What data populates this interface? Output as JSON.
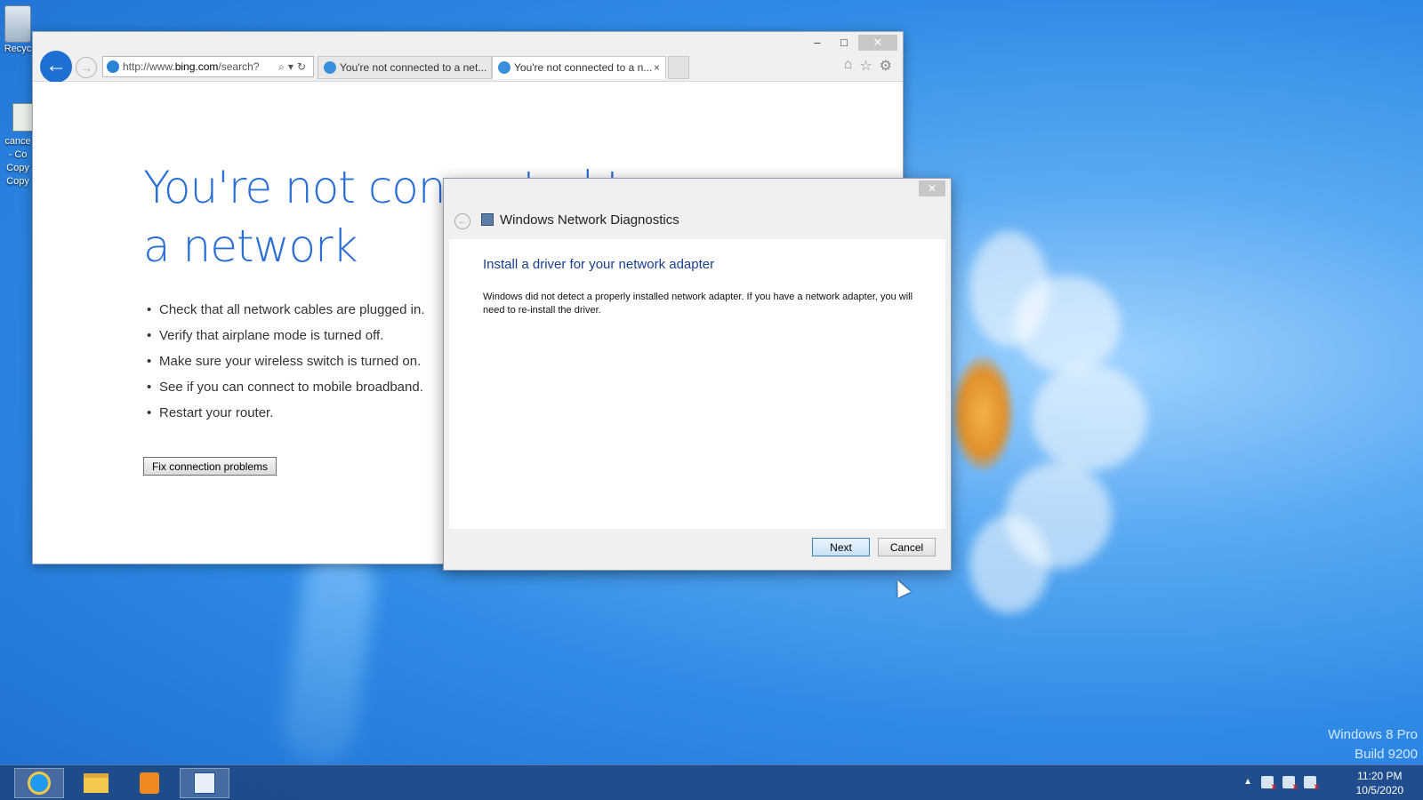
{
  "desktop": {
    "recycle_label": "Recyc",
    "file_label_lines": [
      "cance",
      "- Co",
      "Copy",
      "Copy"
    ],
    "watermark_line1": "Windows 8 Pro",
    "watermark_line2": "Build 9200"
  },
  "browser": {
    "address": {
      "prefix": "http://www.",
      "host": "bing.com",
      "path": "/search?"
    },
    "tabs": [
      {
        "label": "You're not connected to a net..."
      },
      {
        "label": "You're not connected to a n..."
      }
    ],
    "tab_close": "×",
    "controls": {
      "minimize": "–",
      "maximize": "□",
      "close": "✕"
    },
    "content": {
      "title": "You're not connected to a network",
      "bullets": [
        "Check that all network cables are plugged in.",
        "Verify that airplane mode is turned off.",
        "Make sure your wireless switch is turned on.",
        "See if you can connect to mobile broadband.",
        "Restart your router."
      ],
      "fix_button": "Fix connection problems"
    }
  },
  "dialog": {
    "title": "Windows Network Diagnostics",
    "close": "✕",
    "heading": "Install a driver for your network adapter",
    "message": "Windows did not detect a properly installed network adapter. If you have a network adapter, you will need to re-install the driver.",
    "next_button": "Next",
    "cancel_button": "Cancel"
  },
  "taskbar": {
    "time": "11:20 PM",
    "date": "10/5/2020",
    "tray_arrow": "▲"
  }
}
